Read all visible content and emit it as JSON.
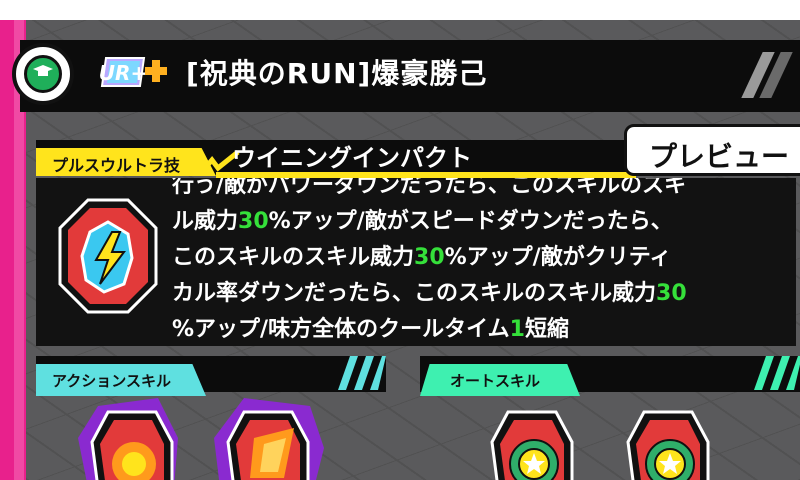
{
  "header": {
    "rarity_label": "UR+",
    "title": "[祝典のRUN]爆豪勝己"
  },
  "skill": {
    "tag_label": "プルスウルトラ技",
    "name": "ウイニングインパクト",
    "preview_label": "プレビュー",
    "description_lines": [
      {
        "parts": [
          "ル威力",
          "30",
          "%アップ/敵がスピードダウンだったら、"
        ]
      },
      {
        "parts": [
          "このスキルのスキル威力",
          "30",
          "%アップ/敵がクリティ"
        ]
      },
      {
        "parts": [
          "カル率ダウンだったら、このスキルのスキル威力",
          "30",
          ""
        ]
      },
      {
        "parts": [
          "%アップ/味方全体のクールタイム",
          "1",
          "短縮"
        ]
      }
    ],
    "cut_line": "行う/敵がパワーダウンだったら、このスキルのスキ"
  },
  "sections": {
    "action_label": "アクションスキル",
    "auto_label": "オートスキル"
  },
  "colors": {
    "accent_pink": "#e8218c",
    "yellow": "#ffe41c",
    "action_cyan": "#5fe0e0",
    "auto_green": "#3ef0b0",
    "highlight_green": "#35e03a"
  }
}
